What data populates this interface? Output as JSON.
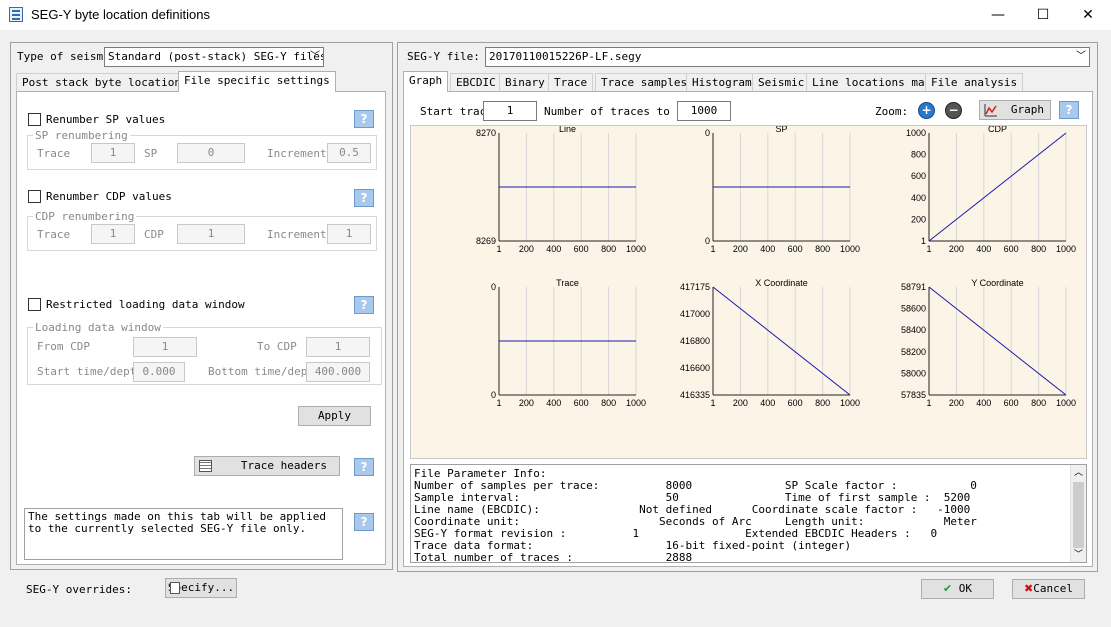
{
  "window": {
    "title": "SEG-Y byte location definitions",
    "minimize_glyph": "—",
    "maximize_glyph": "☐",
    "close_glyph": "✕"
  },
  "left": {
    "type_label": "Type of seismic",
    "type_value": "Standard (post-stack) SEG-Y files",
    "tabs": [
      "Post stack byte locations",
      "File specific settings"
    ],
    "renumber_sp": {
      "label": "Renumber SP values",
      "group": "SP renumbering",
      "trace_label": "Trace",
      "trace_value": "1",
      "sp_label": "SP",
      "sp_value": "0",
      "inc_label": "Increment",
      "inc_value": "0.5"
    },
    "renumber_cdp": {
      "label": "Renumber CDP values",
      "group": "CDP renumbering",
      "trace_label": "Trace",
      "trace_value": "1",
      "cdp_label": "CDP",
      "cdp_value": "1",
      "inc_label": "Increment",
      "inc_value": "1"
    },
    "restricted": {
      "label": "Restricted loading data window",
      "group": "Loading data window",
      "from_label": "From CDP",
      "from_value": "1",
      "to_label": "To CDP",
      "to_value": "1",
      "start_label": "Start time/depth",
      "start_value": "0.000",
      "bottom_label": "Bottom time/depth",
      "bottom_value": "400.000"
    },
    "apply_label": "Apply",
    "trace_headers_label": "Trace headers",
    "note": "The settings made on this tab will be applied to the currently selected SEG-Y file only.",
    "help_glyph": "?"
  },
  "right": {
    "file_label": "SEG-Y file:",
    "file_value": "20170110015226P-LF.segy",
    "tabs": [
      "Graph",
      "EBCDIC",
      "Binary",
      "Trace",
      "Trace samples",
      "Histogram",
      "Seismic",
      "Line locations map",
      "File analysis"
    ],
    "start_trace_label": "Start trace",
    "start_trace_value": "1",
    "num_traces_label": "Number of traces to scan",
    "num_traces_value": "1000",
    "zoom_label": "Zoom:",
    "graph_button": "Graph"
  },
  "chart_data": [
    {
      "type": "line",
      "title": "Line",
      "x": [
        1,
        1000
      ],
      "y": [
        8270,
        8270
      ],
      "ylim": [
        8269,
        8271
      ],
      "yticks": [
        "8270",
        "8269"
      ],
      "xticks": [
        "1",
        "200",
        "400",
        "600",
        "800",
        "1000"
      ],
      "line_level": 0.5
    },
    {
      "type": "line",
      "title": "SP",
      "x": [
        1,
        1000
      ],
      "y": [
        0,
        0
      ],
      "yticks": [
        "0",
        "0"
      ],
      "xticks": [
        "1",
        "200",
        "400",
        "600",
        "800",
        "1000"
      ],
      "line_level": 0.5
    },
    {
      "type": "line",
      "title": "CDP",
      "x": [
        1,
        1000
      ],
      "y": [
        1,
        1000
      ],
      "ylim": [
        1,
        1000
      ],
      "yticks": [
        "1000",
        "800",
        "600",
        "400",
        "200",
        "1"
      ],
      "xticks": [
        "1",
        "200",
        "400",
        "600",
        "800",
        "1000"
      ]
    },
    {
      "type": "line",
      "title": "Trace",
      "x": [
        1,
        1000
      ],
      "y": [
        0,
        0
      ],
      "yticks": [
        "0",
        "0"
      ],
      "xticks": [
        "1",
        "200",
        "400",
        "600",
        "800",
        "1000"
      ],
      "line_level": 0.5
    },
    {
      "type": "line",
      "title": "X Coordinate",
      "x": [
        1,
        1000
      ],
      "y": [
        417175,
        416335
      ],
      "ylim": [
        416335,
        417175
      ],
      "yticks": [
        "417175",
        "417000",
        "416800",
        "416600",
        "416335"
      ],
      "xticks": [
        "1",
        "200",
        "400",
        "600",
        "800",
        "1000"
      ]
    },
    {
      "type": "line",
      "title": "Y Coordinate",
      "x": [
        1,
        1000
      ],
      "y": [
        58791,
        57835
      ],
      "ylim": [
        57835,
        58791
      ],
      "yticks": [
        "58791",
        "58600",
        "58400",
        "58200",
        "58000",
        "57835"
      ],
      "xticks": [
        "1",
        "200",
        "400",
        "600",
        "800",
        "1000"
      ]
    }
  ],
  "info": {
    "rows": [
      "File Parameter Info:",
      "Number of samples per trace:          8000              SP Scale factor :           0",
      "Sample interval:                      50                Time of first sample :  5200",
      "Line name (EBCDIC):               Not defined      Coordinate scale factor :   -1000",
      "Coordinate unit:                     Seconds of Arc     Length unit:            Meter",
      "SEG-Y format revision :          1                Extended EBCDIC Headers :   0",
      "Trace data format:                    16-bit fixed-point (integer)",
      "Total number of traces :              2888"
    ]
  },
  "bottom": {
    "overrides_label": "SEG-Y overrides:",
    "specify_label": "Specify...",
    "ok_label": "OK",
    "cancel_label": "Cancel"
  },
  "colors": {
    "plot_bg": "#fcf5e7",
    "series": "#1a1aaa",
    "ok_green": "#2a9a2a",
    "cancel_red": "#d01010"
  }
}
